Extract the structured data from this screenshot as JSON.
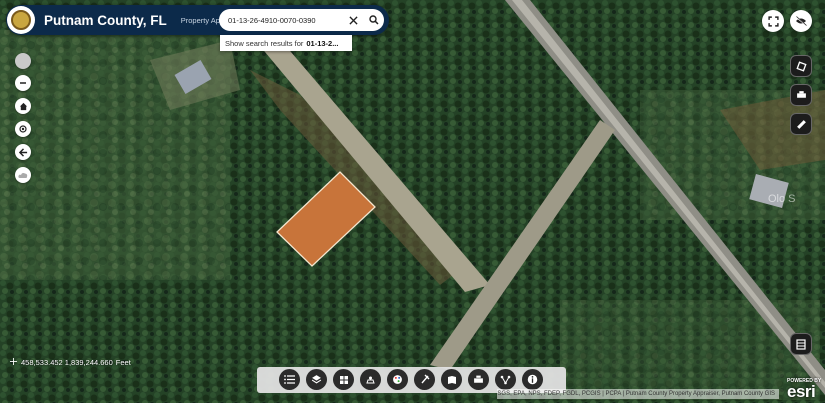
{
  "header": {
    "title": "Putnam County, FL",
    "subtitle": "Property Appraiser"
  },
  "search": {
    "value": "01-13-26-4910-0070-0390",
    "suggestion_prefix": "Show search results for",
    "suggestion_value": "01-13-2..."
  },
  "coordinates": {
    "value": "458,533.452 1,839,244.660",
    "unit": "Feet"
  },
  "attribution": {
    "text": "FDOT, Esri, HERE, Garmin, USGS, EPA, NPS, FDEP, FGDL, PCGIS | PCPA | Putnam County Property Appraiser, Putnam County GIS"
  },
  "esri": {
    "powered_by": "POWERED BY",
    "logo": "esri"
  },
  "map_overlay_text": "Olo S",
  "icons": {
    "left": [
      "basemap-circle-icon",
      "zoom-out-icon",
      "home-icon",
      "locate-icon",
      "back-icon",
      "cloud-icon"
    ],
    "top_right": [
      "fullscreen-icon",
      "hide-icon"
    ],
    "right": [
      "layer-toggle-icon",
      "print-icon",
      "measure-icon",
      "table-icon"
    ],
    "toolbar": [
      "list-icon",
      "layers-icon",
      "grid-icon",
      "select-icon",
      "palette-icon",
      "draw-icon",
      "bookmark-icon",
      "print-icon",
      "share-icon",
      "info-icon"
    ]
  },
  "colors": {
    "header_bg": "#0c2a4a",
    "parcel_fill": "#c8743a",
    "parcel_outline": "#f5e6cf",
    "forest": "#1f3b22"
  }
}
